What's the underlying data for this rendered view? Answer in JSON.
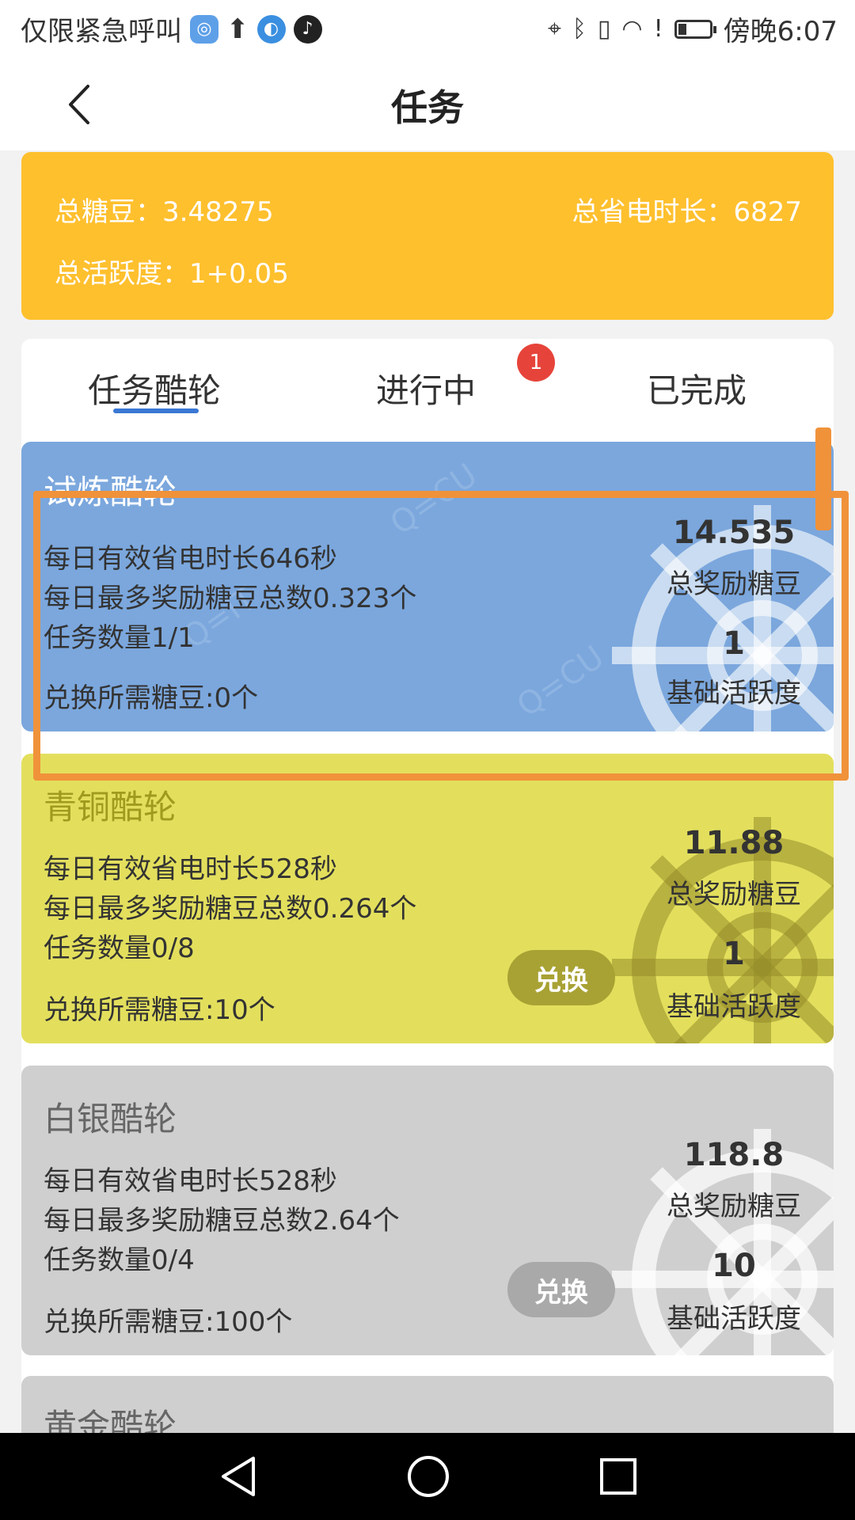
{
  "status_bar": {
    "carrier_text": "仅限紧急呼叫",
    "time": "傍晚6:07",
    "icons": [
      "app-icon",
      "upload-icon",
      "app-icon",
      "tiktok-icon",
      "location-icon",
      "bluetooth-icon",
      "vibrate-icon",
      "wifi-icon",
      "alert-icon",
      "battery-icon"
    ]
  },
  "header": {
    "title": "任务"
  },
  "summary": {
    "total_candy_label": "总糖豆：3.48275",
    "total_saved_label": "总省电时长：6827",
    "total_activity_label": "总活跃度：1+0.05"
  },
  "tabs": [
    {
      "label": "任务酷轮",
      "active": true
    },
    {
      "label": "进行中",
      "badge": "1"
    },
    {
      "label": "已完成"
    }
  ],
  "tiers": [
    {
      "name": "试炼酷轮",
      "color": "#7ba7dd",
      "lines": [
        "每日有效省电时长646秒",
        "每日最多奖励糖豆总数0.323个",
        "任务数量1/1"
      ],
      "cost": "兑换所需糖豆:0个",
      "reward_value": "14.535",
      "reward_label": "总奖励糖豆",
      "activity_value": "1",
      "activity_label": "基础活跃度"
    },
    {
      "name": "青铜酷轮",
      "color": "#e3df5d",
      "lines": [
        "每日有效省电时长528秒",
        "每日最多奖励糖豆总数0.264个",
        "任务数量0/8"
      ],
      "cost": "兑换所需糖豆:10个",
      "exchange": "兑换",
      "reward_value": "11.88",
      "reward_label": "总奖励糖豆",
      "activity_value": "1",
      "activity_label": "基础活跃度"
    },
    {
      "name": "白银酷轮",
      "color": "#cfcfcf",
      "lines": [
        "每日有效省电时长528秒",
        "每日最多奖励糖豆总数2.64个",
        "任务数量0/4"
      ],
      "cost": "兑换所需糖豆:100个",
      "exchange": "兑换",
      "reward_value": "118.8",
      "reward_label": "总奖励糖豆",
      "activity_value": "10",
      "activity_label": "基础活跃度"
    },
    {
      "name": "黄金酷轮",
      "color": "#cfcfcf"
    }
  ],
  "highlight_color": "#f0923a"
}
